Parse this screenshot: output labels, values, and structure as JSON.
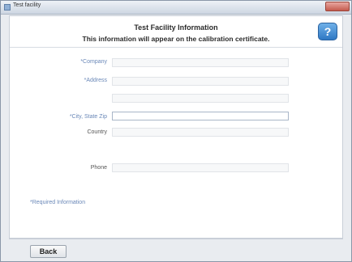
{
  "window": {
    "title": "Test facility"
  },
  "header": {
    "title": "Test Facility Information",
    "subtitle": "This information will appear on the calibration certificate.",
    "help_glyph": "?"
  },
  "form": {
    "company_label": "*Company",
    "address_label": "*Address",
    "city_label": "*City, State Zip",
    "country_label": "Country",
    "phone_label": "Phone",
    "company_value": "",
    "address_value": "",
    "address2_value": "",
    "city_value": "",
    "country_value": "",
    "phone_value": ""
  },
  "required_note": "*Required Information",
  "buttons": {
    "back_label": "Back"
  },
  "colors": {
    "required_label": "#6a88b8",
    "help_button": "#2f78c4"
  }
}
